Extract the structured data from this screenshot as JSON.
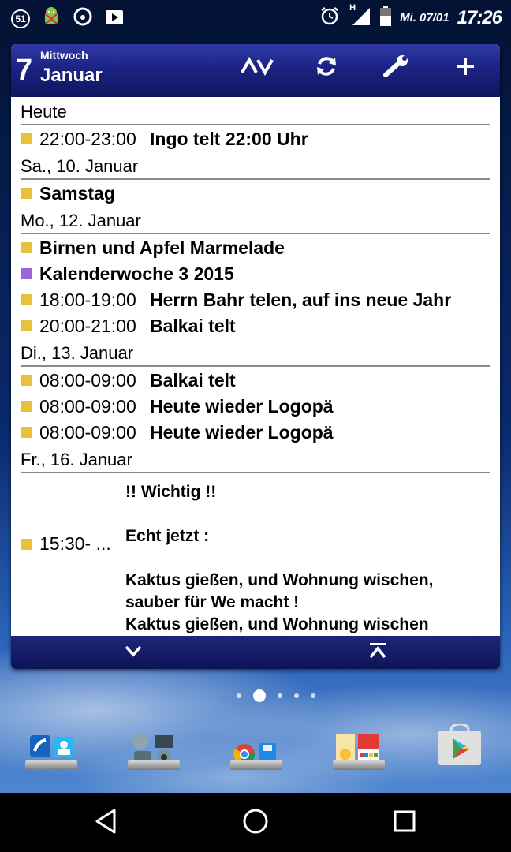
{
  "status_bar": {
    "notification_count": "51",
    "network_type": "H",
    "date": "Mi. 07/01",
    "time": "17:26"
  },
  "widget": {
    "header": {
      "day_number": "7",
      "weekday": "Mittwoch",
      "month": "Januar"
    },
    "colors": {
      "yellow": "#e8c23a",
      "purple": "#9a67d6"
    },
    "days": [
      {
        "label": "Heute",
        "events": [
          {
            "color": "yellow",
            "time": "22:00-23:00",
            "title": "Ingo telt  22:00 Uhr"
          }
        ]
      },
      {
        "label": "Sa., 10. Januar",
        "events": [
          {
            "color": "yellow",
            "time": "",
            "title": "Samstag"
          }
        ]
      },
      {
        "label": "Mo., 12. Januar",
        "events": [
          {
            "color": "yellow",
            "time": "",
            "title": "Birnen und Apfel Marmelade"
          },
          {
            "color": "purple",
            "time": "",
            "title": "Kalenderwoche 3 2015"
          },
          {
            "color": "yellow",
            "time": "18:00-19:00",
            "title": "Herrn Bahr telen,  auf ins neue Jahr"
          },
          {
            "color": "yellow",
            "time": "20:00-21:00",
            "title": "Balkai telt"
          }
        ]
      },
      {
        "label": "Di., 13. Januar",
        "events": [
          {
            "color": "yellow",
            "time": "08:00-09:00",
            "title": "Balkai telt"
          },
          {
            "color": "yellow",
            "time": "08:00-09:00",
            "title": "Heute wieder Logopä"
          },
          {
            "color": "yellow",
            "time": "08:00-09:00",
            "title": "Heute wieder Logopä"
          }
        ]
      },
      {
        "label": "Fr., 16. Januar",
        "events": [
          {
            "color": "yellow",
            "time": "15:30- ...",
            "title": "!! Wichtig !!\n\nEcht jetzt :\n\nKaktus gießen,  und Wohnung wischen,\nsauber für We macht  !\nKaktus gießen,  und Wohnung wischen",
            "multiline": true
          }
        ]
      }
    ]
  },
  "home": {
    "page_count": 5,
    "active_page": 1,
    "dock": [
      "phone-contacts-folder",
      "settings-tools-folder",
      "chrome-storage-folder",
      "office-ebay-folder",
      "play-store-icon"
    ]
  }
}
